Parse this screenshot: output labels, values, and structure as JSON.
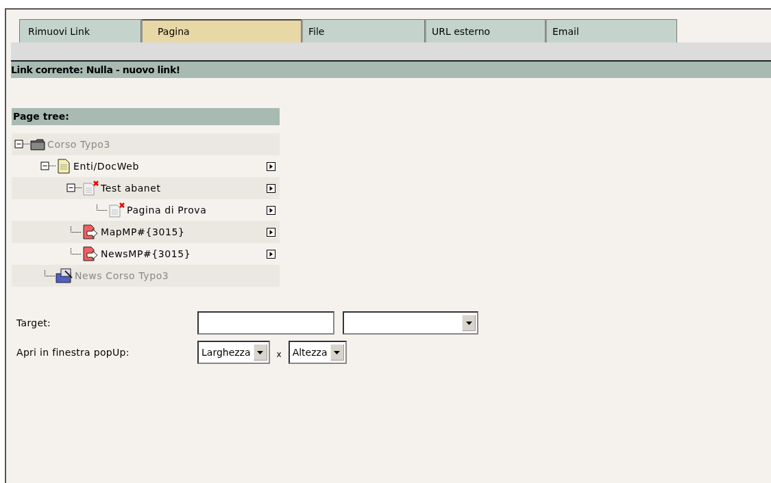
{
  "tabs": [
    {
      "label": "Rimuovi Link",
      "selected": false
    },
    {
      "label": "Pagina",
      "selected": true
    },
    {
      "label": "File",
      "selected": false
    },
    {
      "label": "URL esterno",
      "selected": false
    },
    {
      "label": "Email",
      "selected": false
    }
  ],
  "current_link": "Link corrente: Nulla - nuovo link!",
  "page_tree": {
    "title": "Page tree:",
    "items": [
      {
        "label": "Corso Typo3",
        "kind": "root",
        "greyed": true,
        "arrow": false,
        "expanded": true,
        "children": [
          {
            "label": "Enti/DocWeb",
            "kind": "page",
            "greyed": false,
            "arrow": true,
            "expanded": true,
            "children": [
              {
                "label": "Test abanet",
                "kind": "hidden-page",
                "greyed": false,
                "arrow": true,
                "expanded": true,
                "children": [
                  {
                    "label": "Pagina di Prova",
                    "kind": "hidden-page",
                    "greyed": false,
                    "arrow": true
                  }
                ]
              },
              {
                "label": "MapMP#{3015}",
                "kind": "shortcut",
                "greyed": false,
                "arrow": true
              },
              {
                "label": "NewsMP#{3015}",
                "kind": "shortcut",
                "greyed": false,
                "arrow": true
              }
            ]
          },
          {
            "label": "News Corso Typo3",
            "kind": "news-folder",
            "greyed": true,
            "arrow": false
          }
        ]
      }
    ]
  },
  "target": {
    "label": "Target:"
  },
  "popup": {
    "label": "Apri in finestra popUp:",
    "width_select": "Larghezza",
    "separator": "x",
    "height_select": "Altezza"
  }
}
